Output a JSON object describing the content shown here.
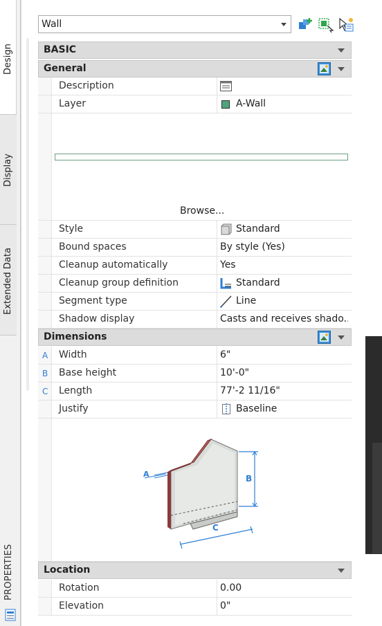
{
  "window": {
    "palette_title": "PROPERTIES",
    "strip_icons": [
      "close-icon",
      "auto-hide-icon",
      "settings-icon"
    ]
  },
  "object_type": {
    "value": "Wall",
    "tool_icons": [
      "add-to-selection-icon",
      "quick-select-icon",
      "select-objects-icon"
    ]
  },
  "tabs": [
    "Design",
    "Display",
    "Extended Data"
  ],
  "sections": {
    "basic": "BASIC",
    "general": "General",
    "dimensions": "Dimensions",
    "location": "Location"
  },
  "general": {
    "description": {
      "name": "Description",
      "value": ""
    },
    "layer": {
      "name": "Layer",
      "value": "A-Wall",
      "swatch_color": "#4ea57a"
    },
    "browse": "Browse...",
    "style": {
      "name": "Style",
      "value": "Standard"
    },
    "bound_spaces": {
      "name": "Bound spaces",
      "value": "By style (Yes)"
    },
    "cleanup_auto": {
      "name": "Cleanup automatically",
      "value": "Yes"
    },
    "cleanup_group": {
      "name": "Cleanup group definition",
      "value": "Standard"
    },
    "segment_type": {
      "name": "Segment type",
      "value": "Line"
    },
    "shadow_display": {
      "name": "Shadow display",
      "value": "Casts and receives shado..."
    }
  },
  "dimensions": {
    "width": {
      "marker": "A",
      "name": "Width",
      "value": "6\""
    },
    "base_height": {
      "marker": "B",
      "name": "Base height",
      "value": "10'-0\""
    },
    "length": {
      "marker": "C",
      "name": "Length",
      "value": "77'-2 11/16\""
    },
    "justify": {
      "name": "Justify",
      "value": "Baseline"
    },
    "diagram_labels": {
      "a": "A",
      "b": "B",
      "c": "C"
    }
  },
  "location": {
    "rotation": {
      "name": "Rotation",
      "value": "0.00"
    },
    "elevation": {
      "name": "Elevation",
      "value": "0\""
    }
  },
  "colors": {
    "accent_blue": "#2f7fd3",
    "section_bg": "#dcdcdc",
    "wall_edge": "#8b3a3a"
  }
}
